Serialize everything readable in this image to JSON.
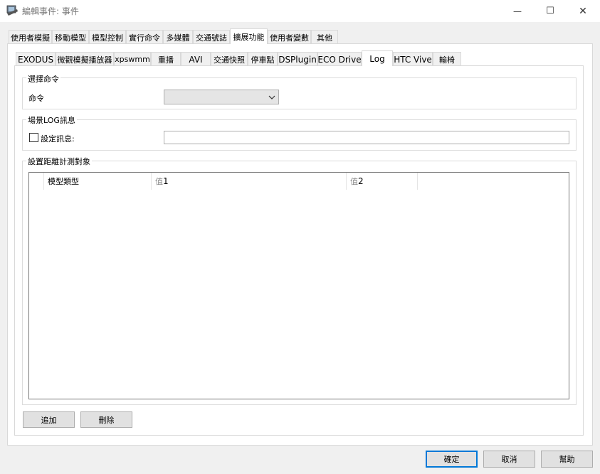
{
  "window": {
    "title": "編輯事件: 事件",
    "minimize_glyph": "—",
    "maximize_glyph": "☐",
    "close_glyph": "✕"
  },
  "outer_tabs": [
    "使用者模擬",
    "移動模型",
    "模型控制",
    "實行命令",
    "多媒體",
    "交通號誌",
    "擴展功能",
    "使用者變數",
    "其他"
  ],
  "outer_active": "擴展功能",
  "inner_tabs": [
    "EXODUS",
    "微觀模擬播放器",
    "xpswmm",
    "重播",
    "AVI",
    "交通快照",
    "停車點",
    "DSPlugin",
    "ECO Drive",
    "Log",
    "HTC Vive",
    "輸椅"
  ],
  "inner_active": "Log",
  "select_command": {
    "group_title": "選擇命令",
    "label": "命令",
    "value": ""
  },
  "scene_log": {
    "group_title": "場景LOG訊息",
    "checkbox_label": "設定訊息:",
    "checked": false,
    "value": ""
  },
  "distance": {
    "group_title": "設置距離計測對象",
    "columns": [
      {
        "label": "模型類型",
        "prefix": ""
      },
      {
        "label": "1",
        "prefix": "值"
      },
      {
        "label": "2",
        "prefix": "值"
      }
    ],
    "rows": []
  },
  "buttons": {
    "add": "追加",
    "delete": "刪除",
    "ok": "確定",
    "cancel": "取消",
    "help": "幫助"
  }
}
